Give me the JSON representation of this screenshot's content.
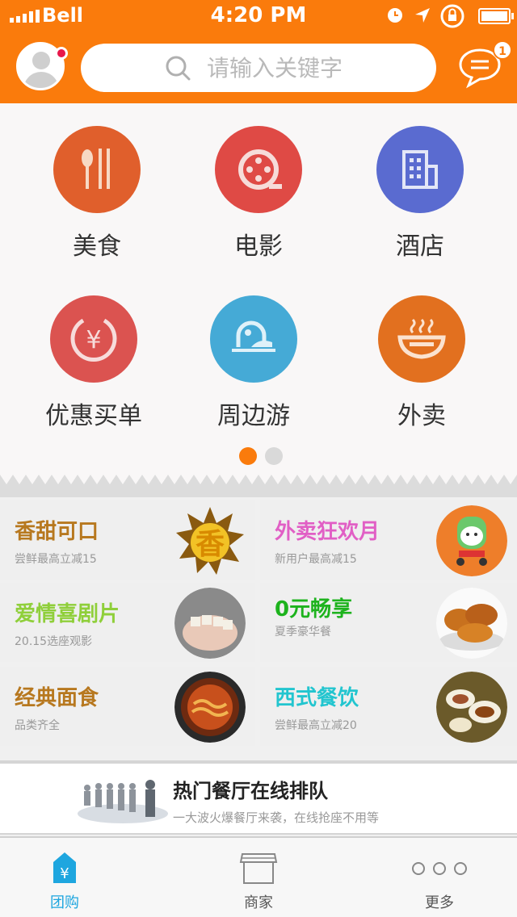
{
  "status_bar": {
    "carrier": "Bell",
    "time": "4:20 PM"
  },
  "header": {
    "search_placeholder": "请输入关键字",
    "message_badge": "1"
  },
  "categories": [
    {
      "label": "美食",
      "color": "#e05f2c",
      "icon": "fork-spoon-icon"
    },
    {
      "label": "电影",
      "color": "#df4a45",
      "icon": "film-reel-icon"
    },
    {
      "label": "酒店",
      "color": "#5a6bd0",
      "icon": "building-icon"
    },
    {
      "label": "优惠买单",
      "color": "#db5350",
      "icon": "yen-coin-icon"
    },
    {
      "label": "周边游",
      "color": "#45aad6",
      "icon": "travel-dome-icon"
    },
    {
      "label": "外卖",
      "color": "#e2701f",
      "icon": "bowl-icon"
    }
  ],
  "pagination": {
    "pages": 2,
    "active": 1
  },
  "promos": [
    {
      "title": "香甜可口",
      "subtitle": "尝鲜最高立减15",
      "color": "#b7781f"
    },
    {
      "title": "外卖狂欢月",
      "subtitle": "新用户最高减15",
      "color": "#e15fc5"
    },
    {
      "title": "爱情喜剧片",
      "subtitle": "20.15选座观影",
      "color": "#8fcf3a"
    },
    {
      "title": "0元畅享",
      "subtitle": "夏季豪华餐",
      "color": "#1db31d"
    },
    {
      "title": "经典面食",
      "subtitle": "品类齐全",
      "color": "#b7781f"
    },
    {
      "title": "西式餐饮",
      "subtitle": "尝鲜最高立减20",
      "color": "#22c5cf"
    }
  ],
  "queue_banner": {
    "title": "热门餐厅在线排队",
    "subtitle": "一大波火爆餐厅来袭，在线抢座不用等"
  },
  "tabbar": [
    {
      "label": "团购",
      "active": true
    },
    {
      "label": "商家",
      "active": false
    },
    {
      "label": "更多",
      "active": false
    }
  ],
  "colors": {
    "brand": "#fa7b0c",
    "tab_active": "#1ea6df"
  }
}
